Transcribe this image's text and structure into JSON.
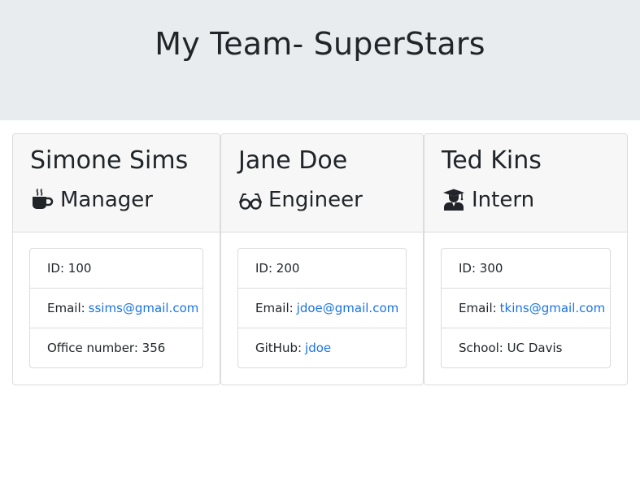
{
  "header": {
    "title": "My Team- SuperStars"
  },
  "cards": [
    {
      "name": "Simone Sims",
      "role": "Manager",
      "role_icon": "coffee-mug-icon",
      "id_label": "ID: 100",
      "email_label": "Email:",
      "email": "ssims@gmail.com",
      "extra_label": "Office number: 356"
    },
    {
      "name": "Jane Doe",
      "role": "Engineer",
      "role_icon": "glasses-icon",
      "id_label": "ID: 200",
      "email_label": "Email:",
      "email": "jdoe@gmail.com",
      "extra_label": "GitHub:",
      "extra_link": "jdoe"
    },
    {
      "name": "Ted Kins",
      "role": "Intern",
      "role_icon": "graduate-icon",
      "id_label": "ID: 300",
      "email_label": "Email:",
      "email": "tkins@gmail.com",
      "extra_label": "School: UC Davis"
    }
  ],
  "colors": {
    "link": "#1b74e4",
    "header_bg": "#e9ecef",
    "card_header_bg": "#f7f7f7"
  }
}
